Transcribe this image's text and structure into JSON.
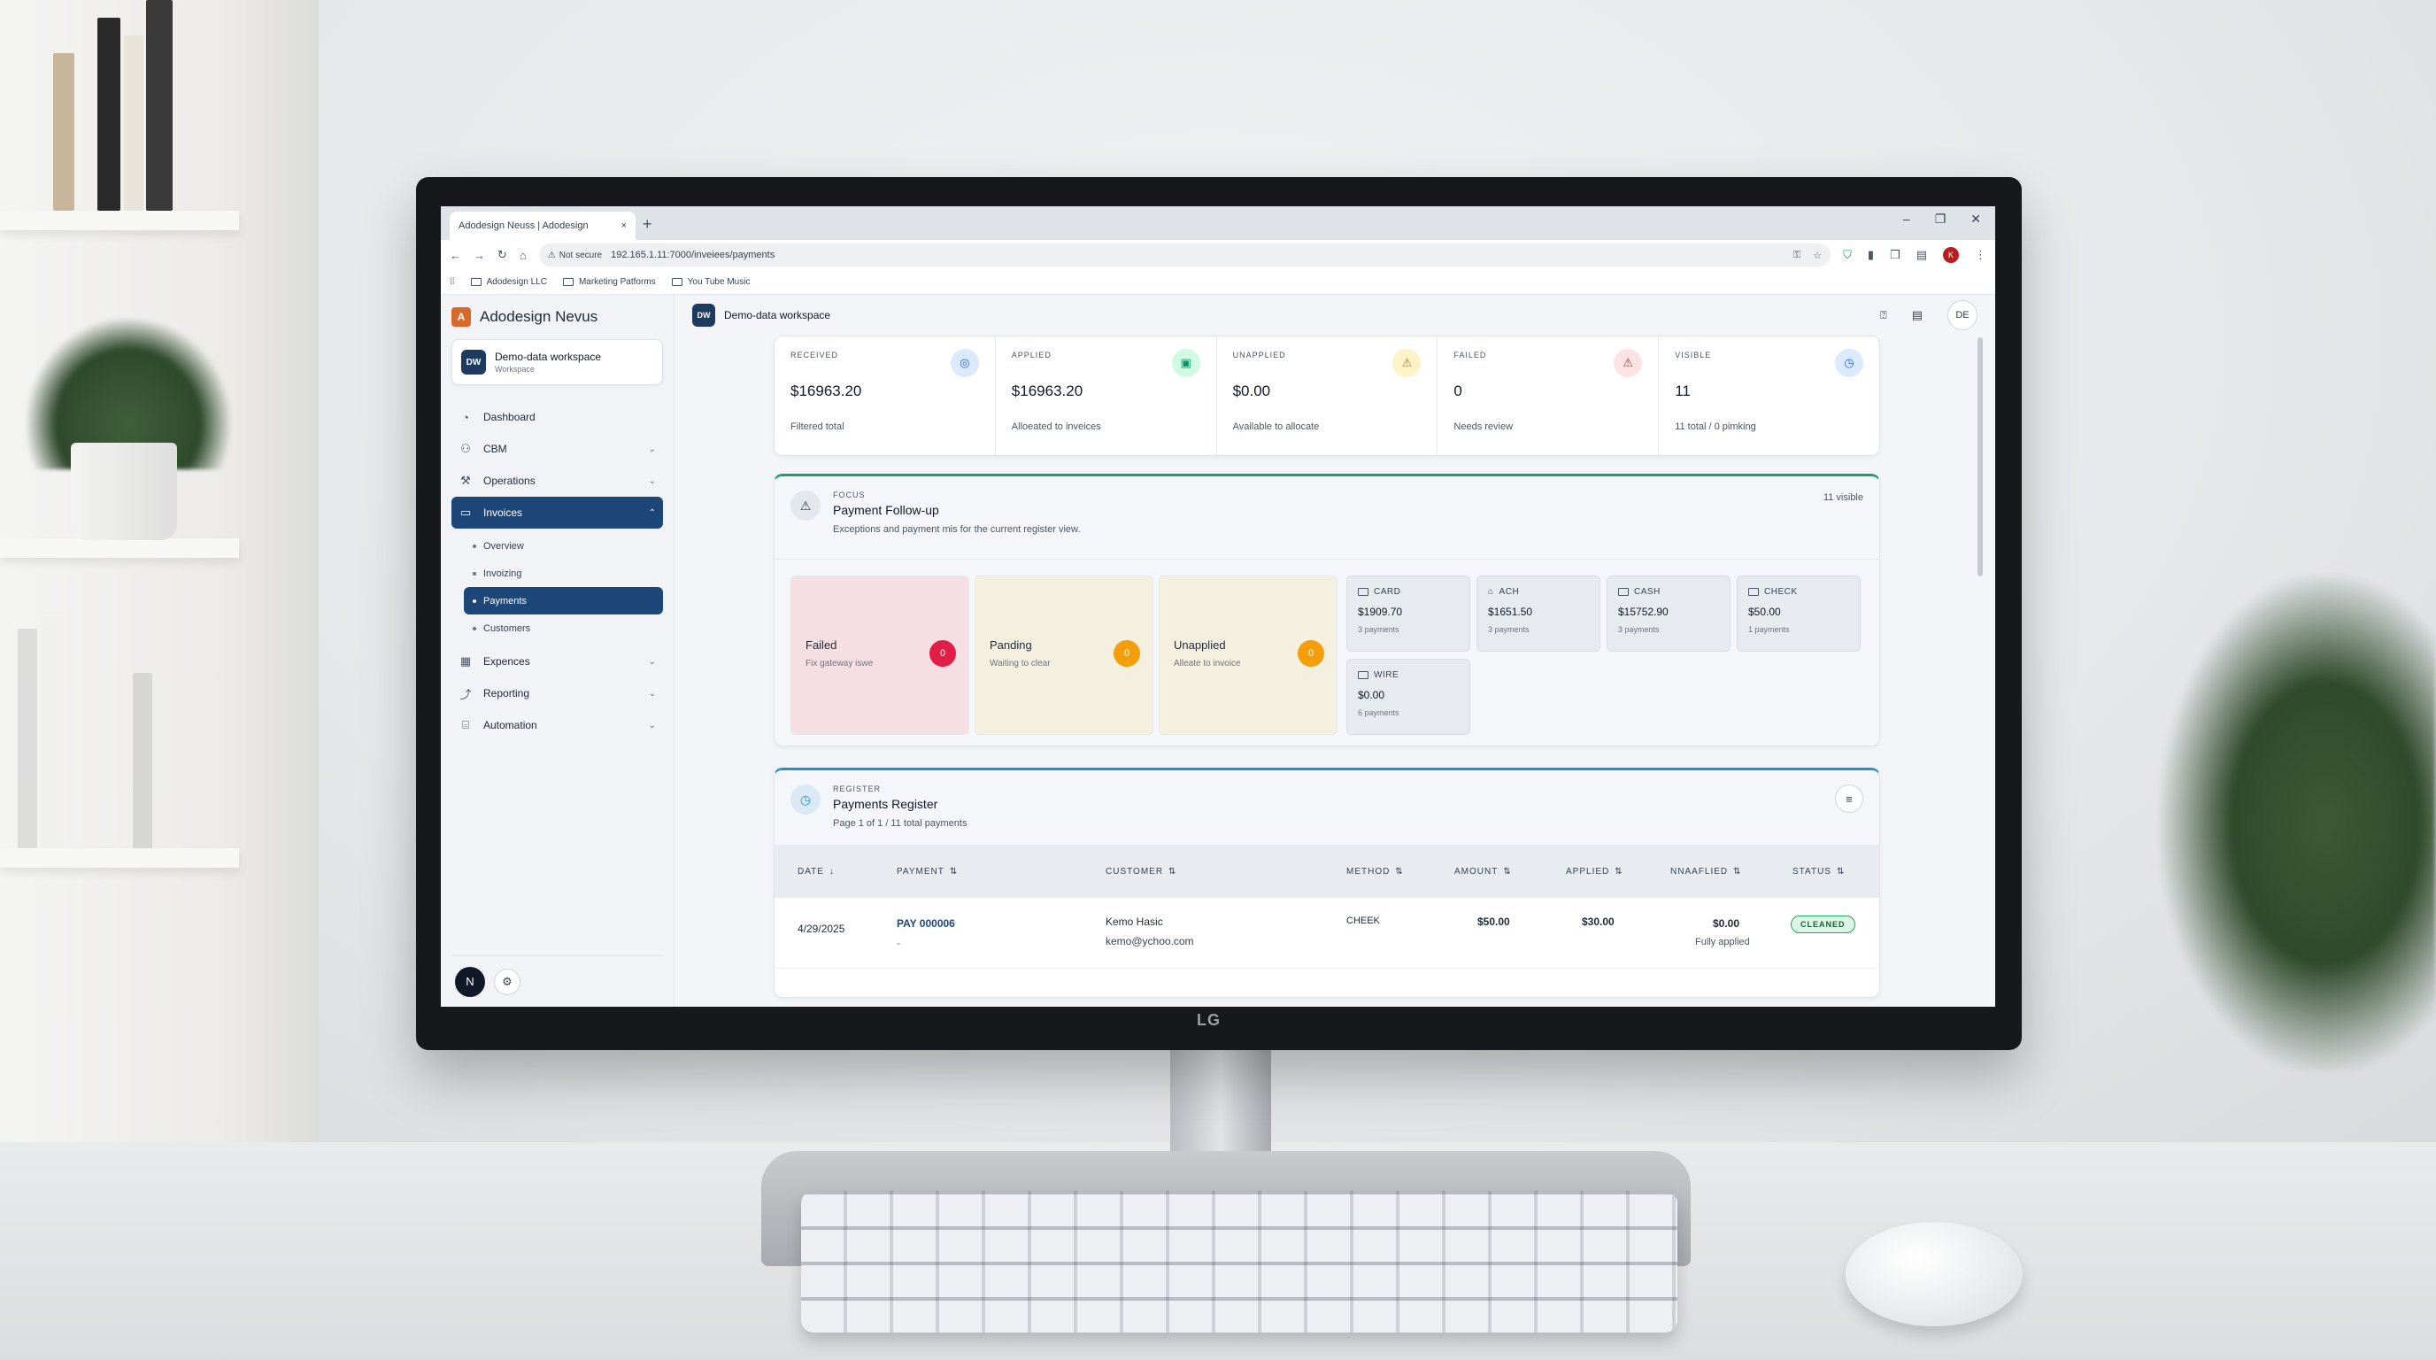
{
  "browser": {
    "tab_title": "Adodesign Neuss | Adodesign",
    "new_tab": "+",
    "close_tab": "×",
    "minimize": "–",
    "restore": "❐",
    "close_window": "✕",
    "not_secure": "Not secure",
    "url": "192.165.1.11:7000/inveiees/payments",
    "profile_initial": "K",
    "bookmarks": [
      "Adodesign LLC",
      "Marketing Patforms",
      "You Tube Music"
    ]
  },
  "sidebar": {
    "brand_initial": "A",
    "brand_name": "Adodesign Nevus",
    "workspace": {
      "initials": "DW",
      "name": "Demo-data workspace",
      "sub": "Workspace"
    },
    "items": [
      {
        "label": "Dashboard",
        "icon": "dashboard-icon"
      },
      {
        "label": "CBM",
        "icon": "users-icon"
      },
      {
        "label": "Operations",
        "icon": "wrench-icon"
      },
      {
        "label": "Invoices",
        "icon": "invoice-icon"
      },
      {
        "label": "Expences",
        "icon": "receipt-icon"
      },
      {
        "label": "Reporting",
        "icon": "trend-icon"
      },
      {
        "label": "Automation",
        "icon": "robot-icon"
      }
    ],
    "invoice_sub": [
      "Overview",
      "Invoizing",
      "Payments",
      "Customers"
    ],
    "user_initial": "N"
  },
  "topbar": {
    "ws_initials": "DW",
    "workspace": "Demo-data workspace",
    "user_initials": "DE"
  },
  "stats": [
    {
      "label": "RECEIVED",
      "value": "$16963.20",
      "sub": "Filtered total",
      "icon": "target-icon",
      "color": "#dbeafe",
      "fg": "#2563eb"
    },
    {
      "label": "APPLIED",
      "value": "$16963.20",
      "sub": "Alloeated to inveices",
      "icon": "calendar-icon",
      "color": "#d1fae5",
      "fg": "#059669"
    },
    {
      "label": "UNAPPLIED",
      "value": "$0.00",
      "sub": "Available to allocate",
      "icon": "warning-icon",
      "color": "#fef3c7",
      "fg": "#d97706"
    },
    {
      "label": "FAILED",
      "value": "0",
      "sub": "Needs review",
      "icon": "alert-icon",
      "color": "#fde2e4",
      "fg": "#dc2626"
    },
    {
      "label": "VISIBLE",
      "value": "11",
      "sub": "11 total / 0 pimking",
      "icon": "clock-icon",
      "color": "#dbeafe",
      "fg": "#2563eb"
    }
  ],
  "focus": {
    "eyebrow": "FOCUS",
    "title": "Payment Follow-up",
    "desc": "Exceptions and payment mis for the current register view.",
    "visible": "11 visible",
    "tiles": [
      {
        "title": "Failed",
        "sub": "Fix gateway iswe",
        "count": "0",
        "bg": "#f6dfe2",
        "badge": "#e11d48"
      },
      {
        "title": "Panding",
        "sub": "Waiting to clear",
        "count": "0",
        "bg": "#f4efdf",
        "badge": "#f59e0b"
      },
      {
        "title": "Unapplied",
        "sub": "Alleate to invoice",
        "count": "0",
        "bg": "#f4efdf",
        "badge": "#f59e0b"
      }
    ],
    "methods": [
      {
        "label": "CARD",
        "amount": "$1909.70",
        "count": "3 payments"
      },
      {
        "label": "ACH",
        "amount": "$1651.50",
        "count": "3 payments"
      },
      {
        "label": "CASH",
        "amount": "$15752.90",
        "count": "3 payments"
      },
      {
        "label": "CHECK",
        "amount": "$50.00",
        "count": "1 payments"
      },
      {
        "label": "WIRE",
        "amount": "$0.00",
        "count": "6 payments"
      }
    ]
  },
  "register": {
    "eyebrow": "REGISTER",
    "title": "Payments Register",
    "desc": "Page 1 of 1 / 11 total payments",
    "columns": [
      "DATE",
      "PAYMENT",
      "CUSTOMER",
      "METHOD",
      "AMOUNT",
      "APPLIED",
      "NNAAFLIED",
      "STATUS"
    ],
    "sort_desc": "↓",
    "sort": "⇅",
    "rows": [
      {
        "date": "4/29/2025",
        "payment": "PAY 000006",
        "payment_sub": "-",
        "customer": "Kemo Hasic",
        "email": "kemo@ychoo.com",
        "method": "CHEEK",
        "amount": "$50.00",
        "applied": "$30.00",
        "unapplied": "$0.00",
        "unapplied_sub": "Fully applied",
        "status": "CLEANED"
      }
    ]
  },
  "monitor": {
    "brand": "LG"
  }
}
